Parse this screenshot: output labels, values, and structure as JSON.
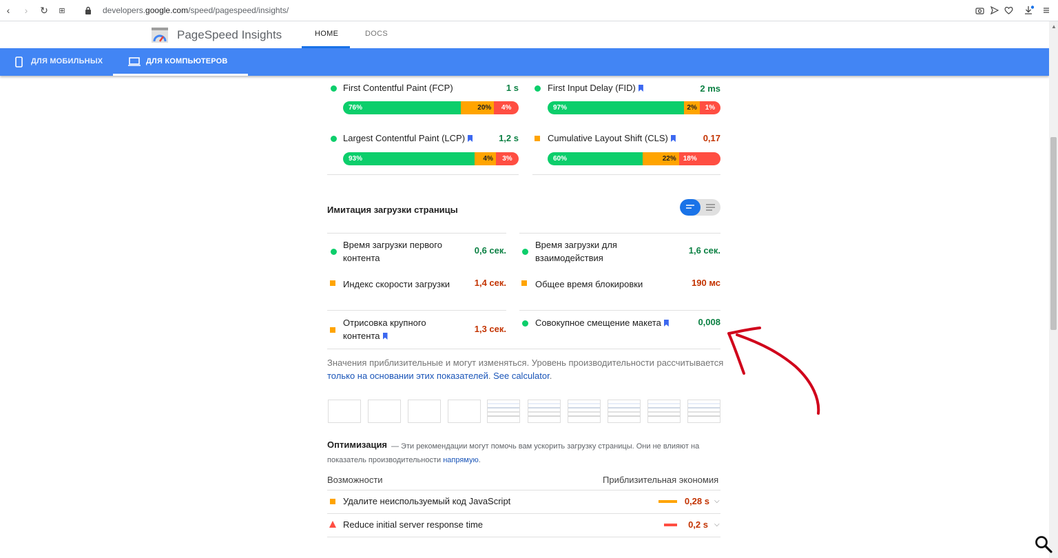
{
  "browser": {
    "url_prefix": "developers.",
    "url_domain": "google.com",
    "url_path": "/speed/pagespeed/insights/"
  },
  "header": {
    "app_title": "PageSpeed Insights",
    "tabs": [
      {
        "label": "HOME"
      },
      {
        "label": "DOCS"
      }
    ]
  },
  "device_tabs": [
    {
      "label": "ДЛЯ МОБИЛЬНЫХ"
    },
    {
      "label": "ДЛЯ КОМПЬЮТЕРОВ"
    }
  ],
  "field_metrics": [
    {
      "label": "First Contentful Paint (FCP)",
      "value": "1 s",
      "status": "good",
      "good": "76%",
      "avg": "20%",
      "poor": "4%",
      "good_pct": 76,
      "avg_pct": 20,
      "poor_pct": 4
    },
    {
      "label": "First Input Delay (FID)",
      "value": "2 ms",
      "status": "good",
      "good": "97%",
      "avg": "2%",
      "poor": "1%",
      "good_pct": 97,
      "avg_pct": 2,
      "poor_pct": 1
    },
    {
      "label": "Largest Contentful Paint (LCP)",
      "value": "1,2 s",
      "status": "good",
      "good": "93%",
      "avg": "4%",
      "poor": "3%",
      "good_pct": 93,
      "avg_pct": 4,
      "poor_pct": 3
    },
    {
      "label": "Cumulative Layout Shift (CLS)",
      "value": "0,17",
      "status": "average",
      "good": "60%",
      "avg": "22%",
      "poor": "18%",
      "good_pct": 60,
      "avg_pct": 22,
      "poor_pct": 18
    }
  ],
  "lab": {
    "title": "Имитация загрузки страницы",
    "metrics": [
      {
        "label": "Время загрузки первого контента",
        "value": "0,6 сек.",
        "status": "good"
      },
      {
        "label": "Время загрузки для взаимодействия",
        "value": "1,6 сек.",
        "status": "good"
      },
      {
        "label": "Индекс скорости загрузки",
        "value": "1,4 сек.",
        "status": "average"
      },
      {
        "label": "Общее время блокировки",
        "value": "190 мс",
        "status": "average"
      },
      {
        "label": "Отрисовка крупного контента",
        "value": "1,3 сек.",
        "status": "average"
      },
      {
        "label": "Совокупное смещение макета",
        "value": "0,008",
        "status": "good"
      }
    ],
    "note_text": "Значения приблизительные и могут изменяться. Уровень производительности рассчитывается ",
    "note_link1": "только на основании этих показателей",
    "note_sep": ". ",
    "note_link2": "See calculator",
    "note_end": "."
  },
  "optimization": {
    "title": "Оптимизация",
    "desc": "— Эти рекомендации могут помочь вам ускорить загрузку страницы. Они не влияют на показатель производительности ",
    "desc_link": "напрямую",
    "desc_end": ".",
    "col_left": "Возможности",
    "col_right": "Приблизительная экономия",
    "items": [
      {
        "label": "Удалите неиспользуемый код JavaScript",
        "value": "0,28 s",
        "status": "average"
      },
      {
        "label": "Reduce initial server response time",
        "value": "0,2 s",
        "status": "poor"
      }
    ]
  },
  "colors": {
    "brand_blue": "#4285f4",
    "good": "#0cce6b",
    "average": "#ffa400",
    "poor": "#ff4e42",
    "annotation": "#d0021b"
  }
}
